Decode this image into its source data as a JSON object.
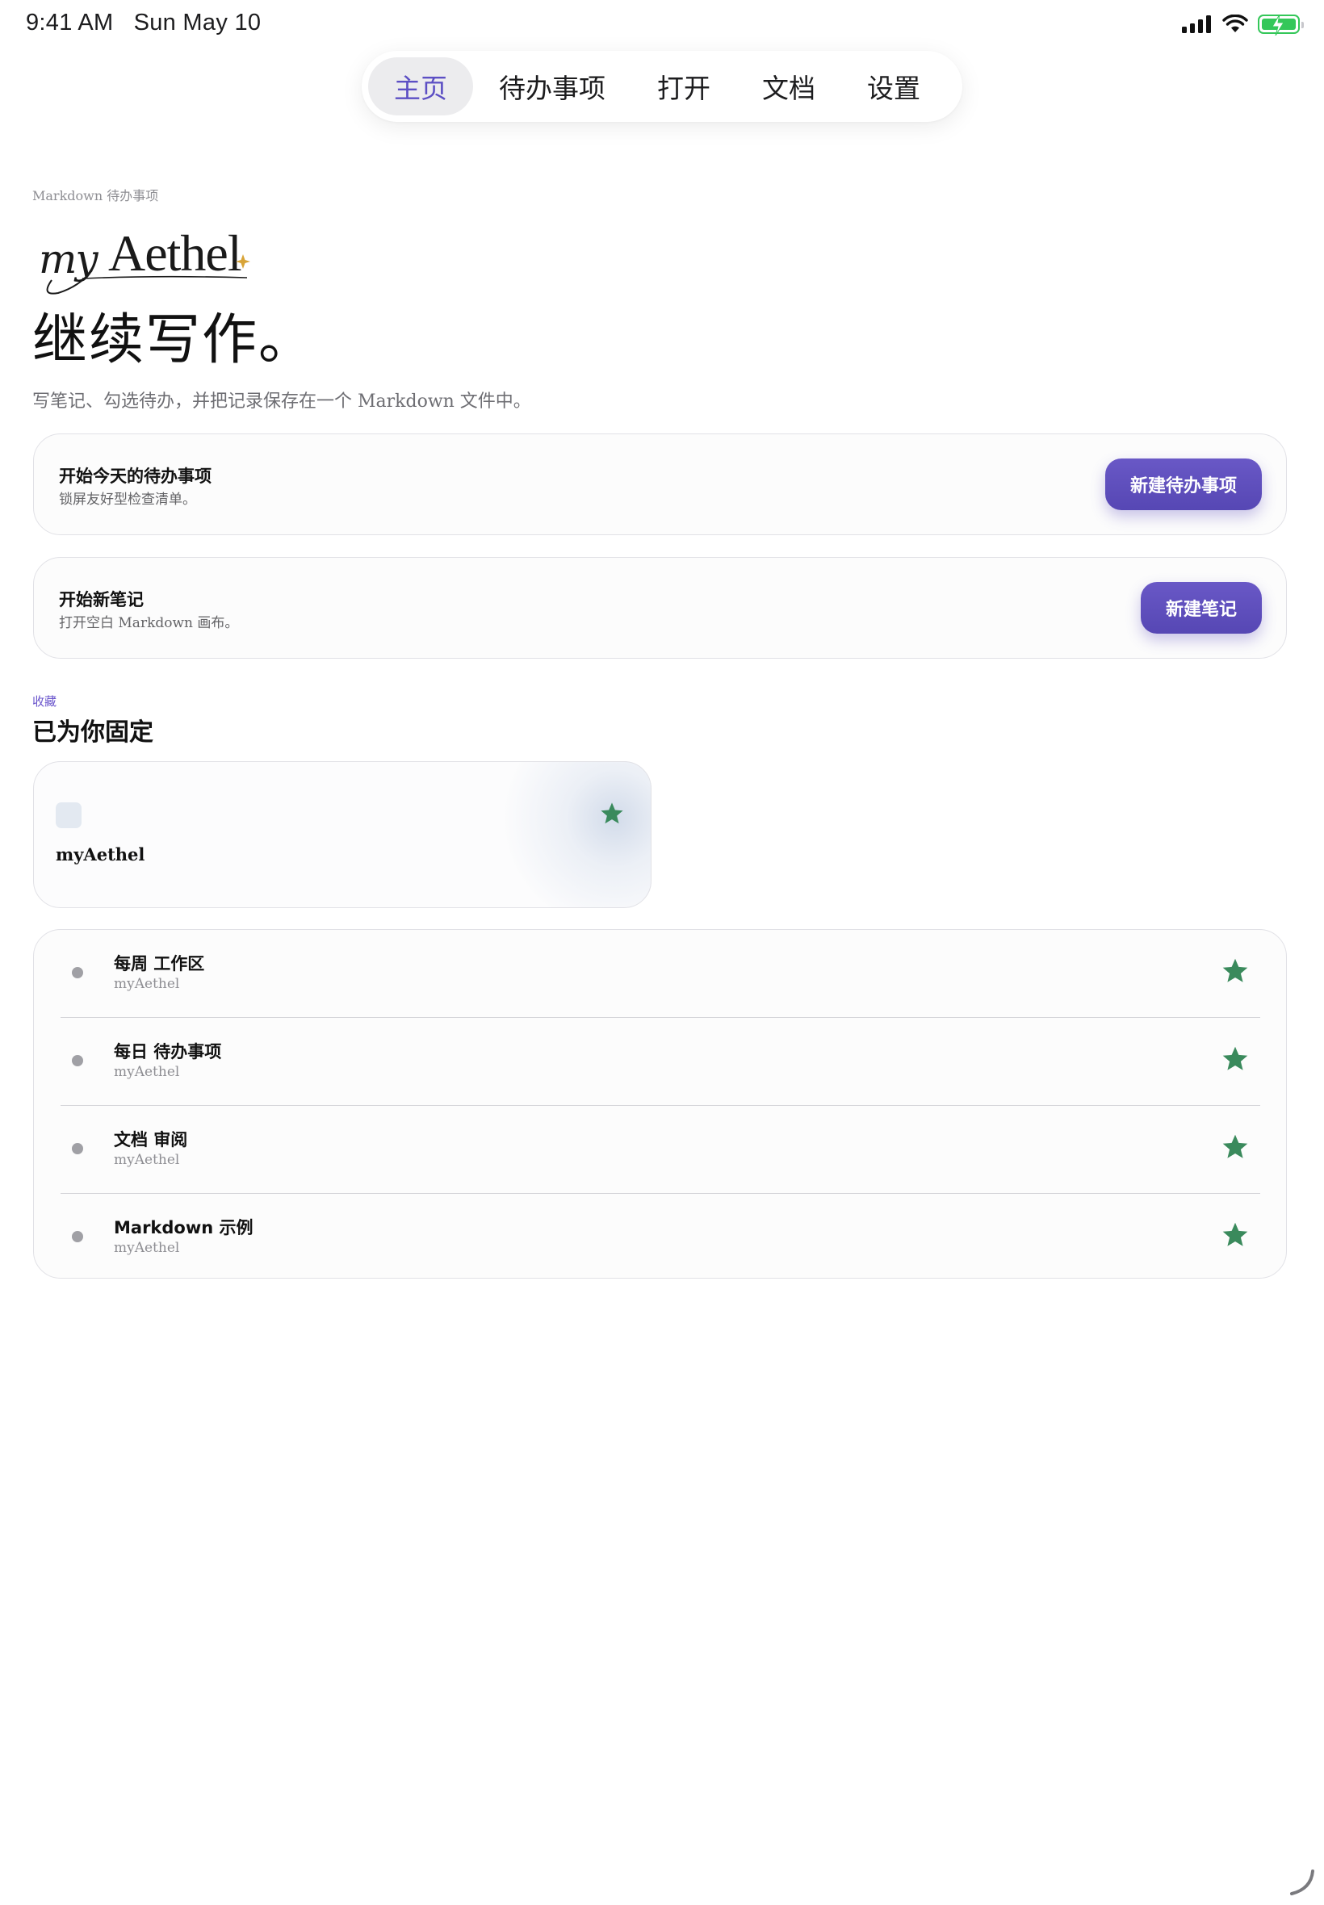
{
  "status_bar": {
    "time": "9:41 AM",
    "date": "Sun May 10",
    "battery_color": "#34c759"
  },
  "nav": {
    "tabs": [
      {
        "label": "主页",
        "active": true
      },
      {
        "label": "待办事项",
        "active": false
      },
      {
        "label": "打开",
        "active": false
      },
      {
        "label": "文档",
        "active": false
      },
      {
        "label": "设置",
        "active": false
      }
    ],
    "accent": "#5c4fc4"
  },
  "header": {
    "eyebrow": "Markdown 待办事项",
    "logo_text": "myAethel",
    "title": "继续写作。",
    "subtitle": "写笔记、勾选待办，并把记录保存在一个 Markdown 文件中。"
  },
  "actions": [
    {
      "title": "开始今天的待办事项",
      "description": "锁屏友好型检查清单。",
      "button": "新建待办事项"
    },
    {
      "title": "开始新笔记",
      "description": "打开空白 Markdown 画布。",
      "button": "新建笔记"
    }
  ],
  "pinned": {
    "eyebrow": "收藏",
    "title": "已为你固定",
    "featured": {
      "label": "myAethel",
      "starred": true
    },
    "items": [
      {
        "title": "每周 工作区",
        "subtitle": "myAethel",
        "starred": true
      },
      {
        "title": "每日 待办事项",
        "subtitle": "myAethel",
        "starred": true
      },
      {
        "title": "文档 审阅",
        "subtitle": "myAethel",
        "starred": true
      },
      {
        "title": "Markdown 示例",
        "subtitle": "myAethel",
        "starred": true
      }
    ],
    "star_color": "#3a8a5c"
  },
  "icons": [
    "cellular-signal-icon",
    "wifi-icon",
    "battery-charging-icon",
    "star-icon",
    "sparkle-icon",
    "resize-handle-icon"
  ]
}
